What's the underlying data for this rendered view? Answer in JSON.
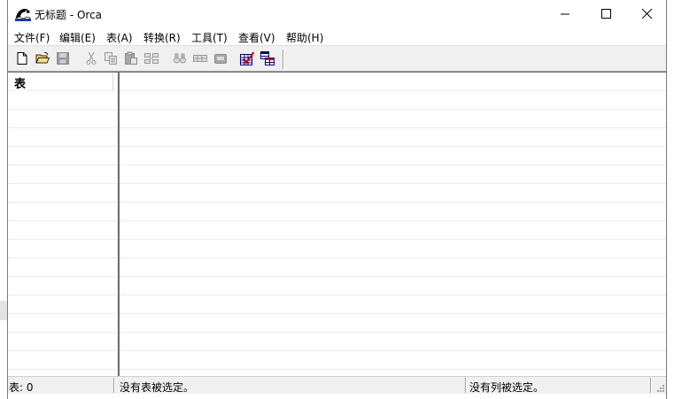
{
  "window": {
    "title": "无标题 - Orca"
  },
  "menu": [
    {
      "label": "文件(F)"
    },
    {
      "label": "编辑(E)"
    },
    {
      "label": "表(A)"
    },
    {
      "label": "转换(R)"
    },
    {
      "label": "工具(T)"
    },
    {
      "label": "查看(V)"
    },
    {
      "label": "帮助(H)"
    }
  ],
  "toolbar": {
    "buttons": [
      {
        "icon": "new-file-icon",
        "enabled": true
      },
      {
        "icon": "open-folder-icon",
        "enabled": true
      },
      {
        "icon": "save-icon",
        "enabled": false
      },
      {
        "icon": "cut-icon",
        "enabled": false
      },
      {
        "icon": "copy-icon",
        "enabled": false
      },
      {
        "icon": "paste-icon",
        "enabled": false
      },
      {
        "icon": "paste-rows-icon",
        "enabled": false
      },
      {
        "icon": "find-icon",
        "enabled": false
      },
      {
        "icon": "add-row-icon",
        "enabled": false
      },
      {
        "icon": "remove-row-icon",
        "enabled": false
      },
      {
        "icon": "validate-icon",
        "enabled": true
      },
      {
        "icon": "tables-icon",
        "enabled": true
      }
    ]
  },
  "tables_pane": {
    "header": "表"
  },
  "status": {
    "table_count": "表: 0",
    "no_table_selected": "没有表被选定。",
    "no_column_selected": "没有列被选定。"
  },
  "colors": {
    "window_bg": "#ffffff",
    "chrome_bg": "#f0f0f0",
    "gridline": "#ececec",
    "icon_red": "#cc0000",
    "icon_navy": "#000080"
  }
}
